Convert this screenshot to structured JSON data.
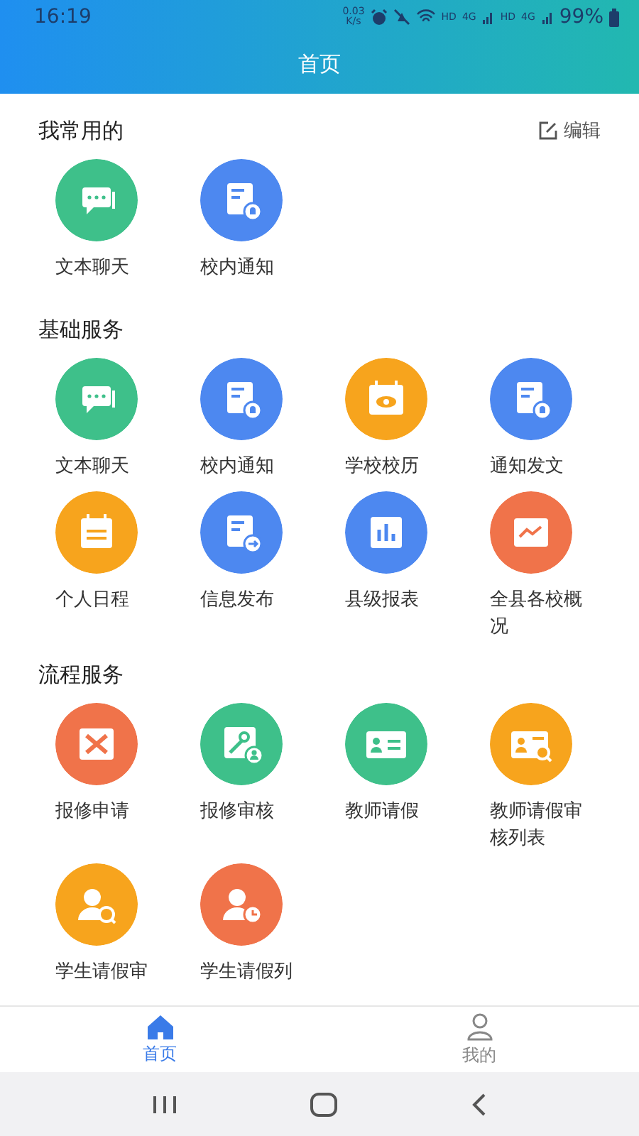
{
  "status_bar": {
    "time": "16:19",
    "speed_value": "0.03",
    "speed_unit": "K/s",
    "network_labels": [
      "HD",
      "4G",
      "HD",
      "4G"
    ],
    "battery": "99%"
  },
  "header": {
    "title": "首页"
  },
  "sections": [
    {
      "title": "我常用的",
      "action": "编辑",
      "items": [
        {
          "label": "文本聊天",
          "kind": "chat",
          "color": "#3ec08a"
        },
        {
          "label": "校内通知",
          "kind": "notice",
          "color": "#4d88f0"
        }
      ]
    },
    {
      "title": "基础服务",
      "items": [
        {
          "label": "文本聊天",
          "kind": "chat",
          "color": "#3ec08a"
        },
        {
          "label": "校内通知",
          "kind": "notice",
          "color": "#4d88f0"
        },
        {
          "label": "学校校历",
          "kind": "calendar",
          "color": "#f7a41d"
        },
        {
          "label": "通知发文",
          "kind": "notice",
          "color": "#4d88f0"
        },
        {
          "label": "个人日程",
          "kind": "schedule",
          "color": "#f7a41d"
        },
        {
          "label": "信息发布",
          "kind": "publish",
          "color": "#4d88f0"
        },
        {
          "label": "县级报表",
          "kind": "report",
          "color": "#4d88f0"
        },
        {
          "label": "全县各校概况",
          "kind": "trend",
          "color": "#f0734a"
        }
      ]
    },
    {
      "title": "流程服务",
      "items": [
        {
          "label": "报修申请",
          "kind": "repair",
          "color": "#f0734a"
        },
        {
          "label": "报修审核",
          "kind": "repair-review",
          "color": "#3ec08a"
        },
        {
          "label": "教师请假",
          "kind": "card",
          "color": "#3ec08a"
        },
        {
          "label": "教师请假审核列表",
          "kind": "card-search",
          "color": "#f7a41d"
        },
        {
          "label": "学生请假审",
          "kind": "person-search",
          "color": "#f7a41d"
        },
        {
          "label": "学生请假列",
          "kind": "person-clock",
          "color": "#f0734a"
        }
      ]
    }
  ],
  "tabs": [
    {
      "label": "首页",
      "kind": "home",
      "selected": true
    },
    {
      "label": "我的",
      "kind": "person",
      "selected": false
    }
  ]
}
